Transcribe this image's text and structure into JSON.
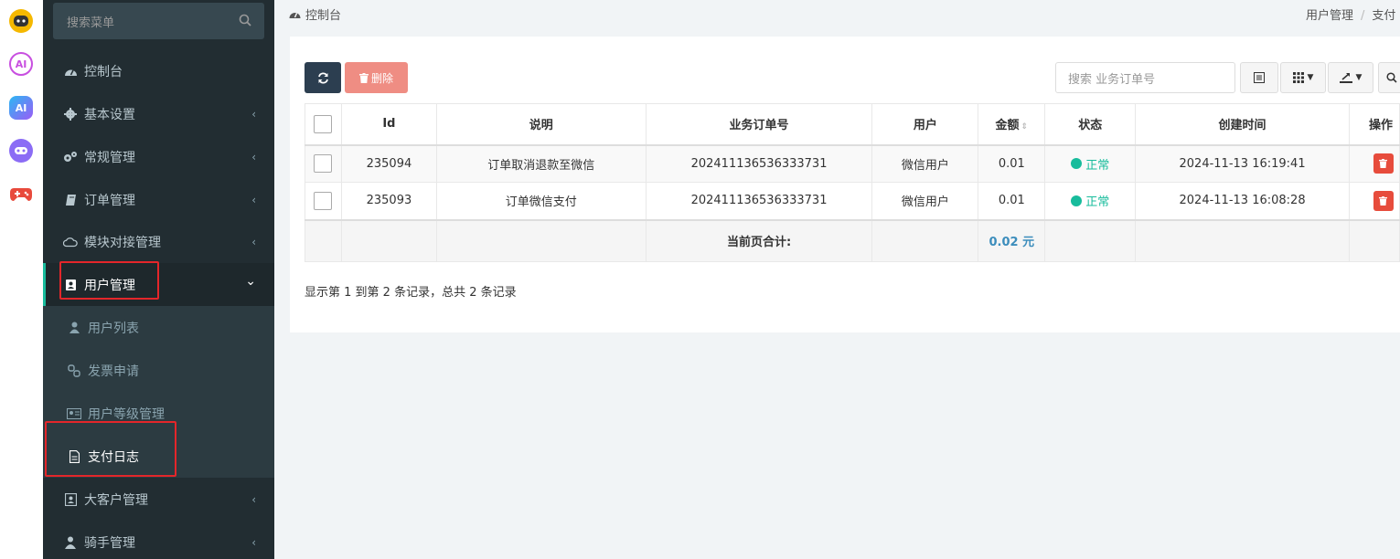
{
  "app_strip": {
    "icons": [
      "chat-bot-icon",
      "ai-assistant-icon",
      "ai-tool-icon",
      "discord-bot-icon",
      "game-controller-icon"
    ],
    "labels": [
      "",
      "AI",
      "AI",
      "",
      ""
    ]
  },
  "sidebar": {
    "search_placeholder": "搜索菜单",
    "items": [
      {
        "label": "控制台",
        "icon": "dashboard-icon",
        "has_children": false
      },
      {
        "label": "基本设置",
        "icon": "gear-icon",
        "has_children": true
      },
      {
        "label": "常规管理",
        "icon": "cogs-icon",
        "has_children": true
      },
      {
        "label": "订单管理",
        "icon": "book-icon",
        "has_children": true
      },
      {
        "label": "模块对接管理",
        "icon": "cloud-icon",
        "has_children": true
      },
      {
        "label": "用户管理",
        "icon": "address-book-icon",
        "has_children": true,
        "expanded": true
      },
      {
        "label": "大客户管理",
        "icon": "contact-card-icon",
        "has_children": true
      },
      {
        "label": "骑手管理",
        "icon": "rider-icon",
        "has_children": true
      }
    ],
    "submenu": [
      {
        "label": "用户列表",
        "icon": "user-icon"
      },
      {
        "label": "发票申请",
        "icon": "chain-icon"
      },
      {
        "label": "用户等级管理",
        "icon": "id-card-icon"
      },
      {
        "label": "支付日志",
        "icon": "file-icon",
        "current": true
      }
    ],
    "chevron_collapsed": "‹",
    "chevron_expanded": "⌄"
  },
  "breadcrumb": {
    "left": "控制台",
    "right_parent": "用户管理",
    "right_sep": "/",
    "right_current": "支付"
  },
  "toolbar": {
    "delete_label": "删除",
    "search_placeholder": "搜索 业务订单号"
  },
  "table": {
    "columns": [
      "Id",
      "说明",
      "业务订单号",
      "用户",
      "金额",
      "状态",
      "创建时间",
      "操作"
    ],
    "rows": [
      {
        "id": "235094",
        "desc": "订单取消退款至微信",
        "order_no": "202411136536333731",
        "user": "微信用户",
        "amount": "0.01",
        "status": "正常",
        "created": "2024-11-13 16:19:41"
      },
      {
        "id": "235093",
        "desc": "订单微信支付",
        "order_no": "202411136536333731",
        "user": "微信用户",
        "amount": "0.01",
        "status": "正常",
        "created": "2024-11-13 16:08:28"
      }
    ],
    "footer_label": "当前页合计:",
    "footer_amount": "0.02 元"
  },
  "pager_text": "显示第 1 到第 2 条记录，总共 2 条记录",
  "colors": {
    "accent": "#18bc9c",
    "sidebar": "#222d32",
    "danger": "#e74c3c",
    "highlight_box": "#e4262a"
  }
}
